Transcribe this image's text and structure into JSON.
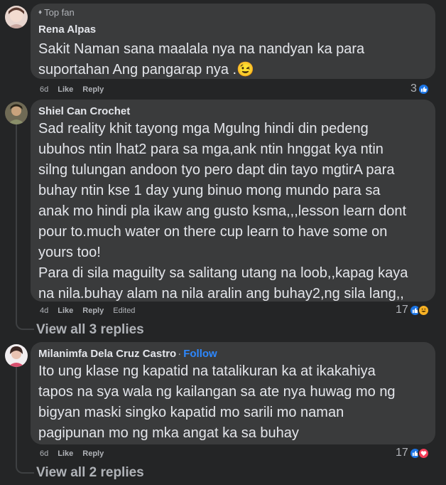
{
  "comments": [
    {
      "badge": "Top fan",
      "author": "Rena Alpas",
      "text": "Sakit Naman sana maalala nya na nandyan ka para\nsuportahan Ang pangarap nya .😉",
      "age": "6d",
      "like": "Like",
      "reply": "Reply",
      "reaction_count": "3",
      "reactions": [
        "like-icon"
      ]
    },
    {
      "author": "Shiel Can Crochet",
      "text": "Sad reality khit tayong mga Mgulng hindi din pedeng\nubuhos ntin lhat2 para sa mga,ank ntin hnggat kya ntin\nsilng tulungan andoon tyo pero dapt din tayo mgtirA para\nbuhay ntin kse 1 day yung binuo mong mundo para sa\nanak mo hindi pla ikaw ang gusto ksma,,,lesson learn dont\npour to.much water on there cup learn to have some on\nyours too!\nPara di sila maguilty sa salitang utang na loob,,kapag kaya\nna nila.buhay alam na nila aralin ang buhay2,ng sila lang,,",
      "age": "4d",
      "like": "Like",
      "reply": "Reply",
      "edited": "Edited",
      "reaction_count": "17",
      "reactions": [
        "like-icon",
        "haha-icon"
      ],
      "view_replies": "View all 3 replies"
    },
    {
      "author": "Milanimfa Dela Cruz Castro",
      "dot": "·",
      "follow": "Follow",
      "text": "Ito ung klase ng kapatid na tatalikuran ka at ikakahiya\ntapos na sya wala ng kailangan sa ate nya huwag mo ng\nbigyan maski singko kapatid mo sarili mo naman\npagipunan mo ng mka angat ka sa buhay",
      "age": "6d",
      "like": "Like",
      "reply": "Reply",
      "reaction_count": "17",
      "reactions": [
        "like-icon",
        "love-icon"
      ],
      "view_replies": "View all 2 replies"
    }
  ],
  "colors": {
    "background": "#242526",
    "bubble": "#3a3b3c",
    "text": "#e4e6eb",
    "muted": "#b0b3b8",
    "link": "#2d88ff",
    "like": "#1b74e4",
    "haha": "#f7b125",
    "love": "#f33e58"
  }
}
